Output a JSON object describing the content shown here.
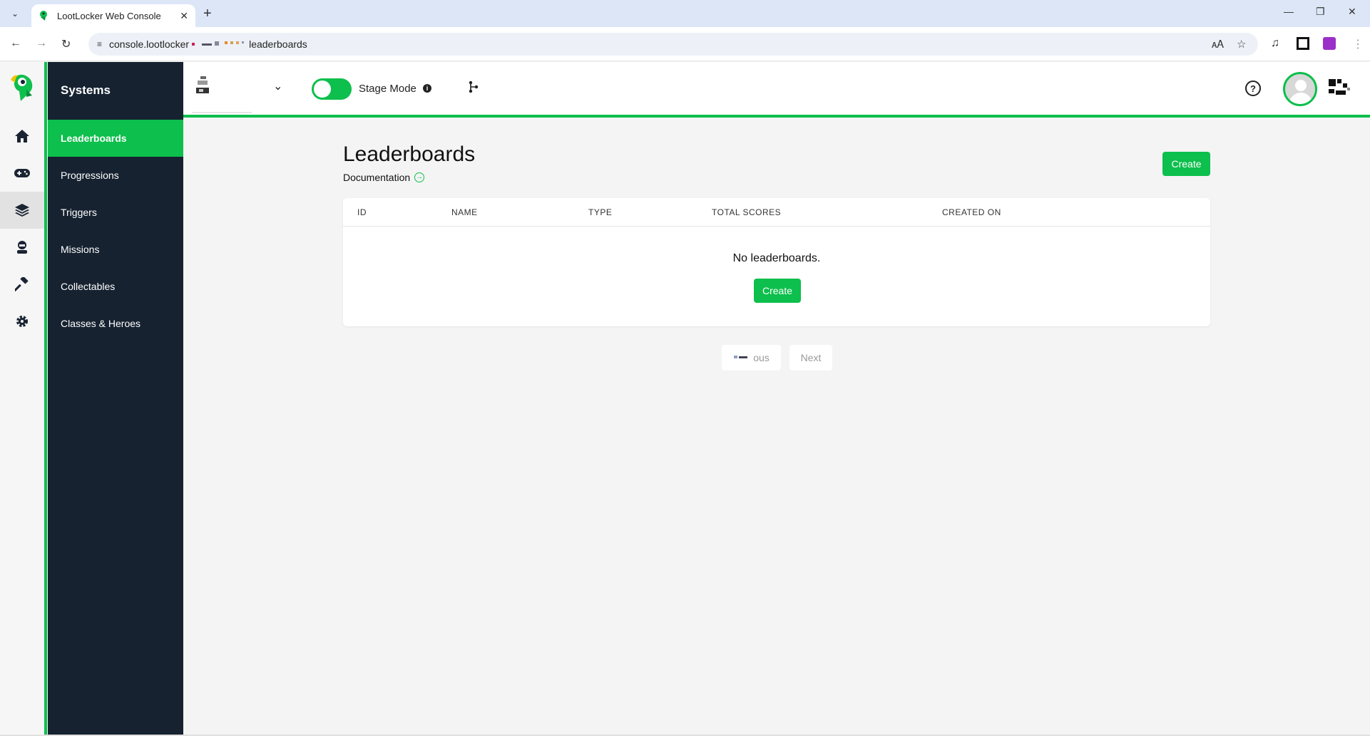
{
  "browser": {
    "tab_title": "LootLocker Web Console",
    "url_prefix": "console.lootlocker",
    "url_suffix": "leaderboards"
  },
  "colors": {
    "accent": "#0dbf4c",
    "sidebar_bg": "#162230"
  },
  "rail": {
    "icons": [
      "parrot-logo-icon",
      "home-icon",
      "gamepad-icon",
      "layers-icon",
      "player-icon",
      "hammer-icon",
      "gear-icon"
    ],
    "active_index": 3
  },
  "sidebar": {
    "heading": "Systems",
    "items": [
      {
        "label": "Leaderboards",
        "active": true
      },
      {
        "label": "Progressions"
      },
      {
        "label": "Triggers"
      },
      {
        "label": "Missions"
      },
      {
        "label": "Collectables"
      },
      {
        "label": "Classes & Heroes"
      }
    ]
  },
  "topbar": {
    "stage_mode_label": "Stage Mode",
    "stage_mode_on": true,
    "info_glyph": "i",
    "help_glyph": "?"
  },
  "main": {
    "title": "Leaderboards",
    "doc_link": "Documentation",
    "create_label": "Create",
    "columns": [
      "ID",
      "NAME",
      "TYPE",
      "TOTAL SCORES",
      "CREATED ON"
    ],
    "empty_text": "No leaderboards.",
    "empty_create_label": "Create",
    "pager": {
      "previous_fragment": "ous",
      "next_label": "Next"
    }
  }
}
